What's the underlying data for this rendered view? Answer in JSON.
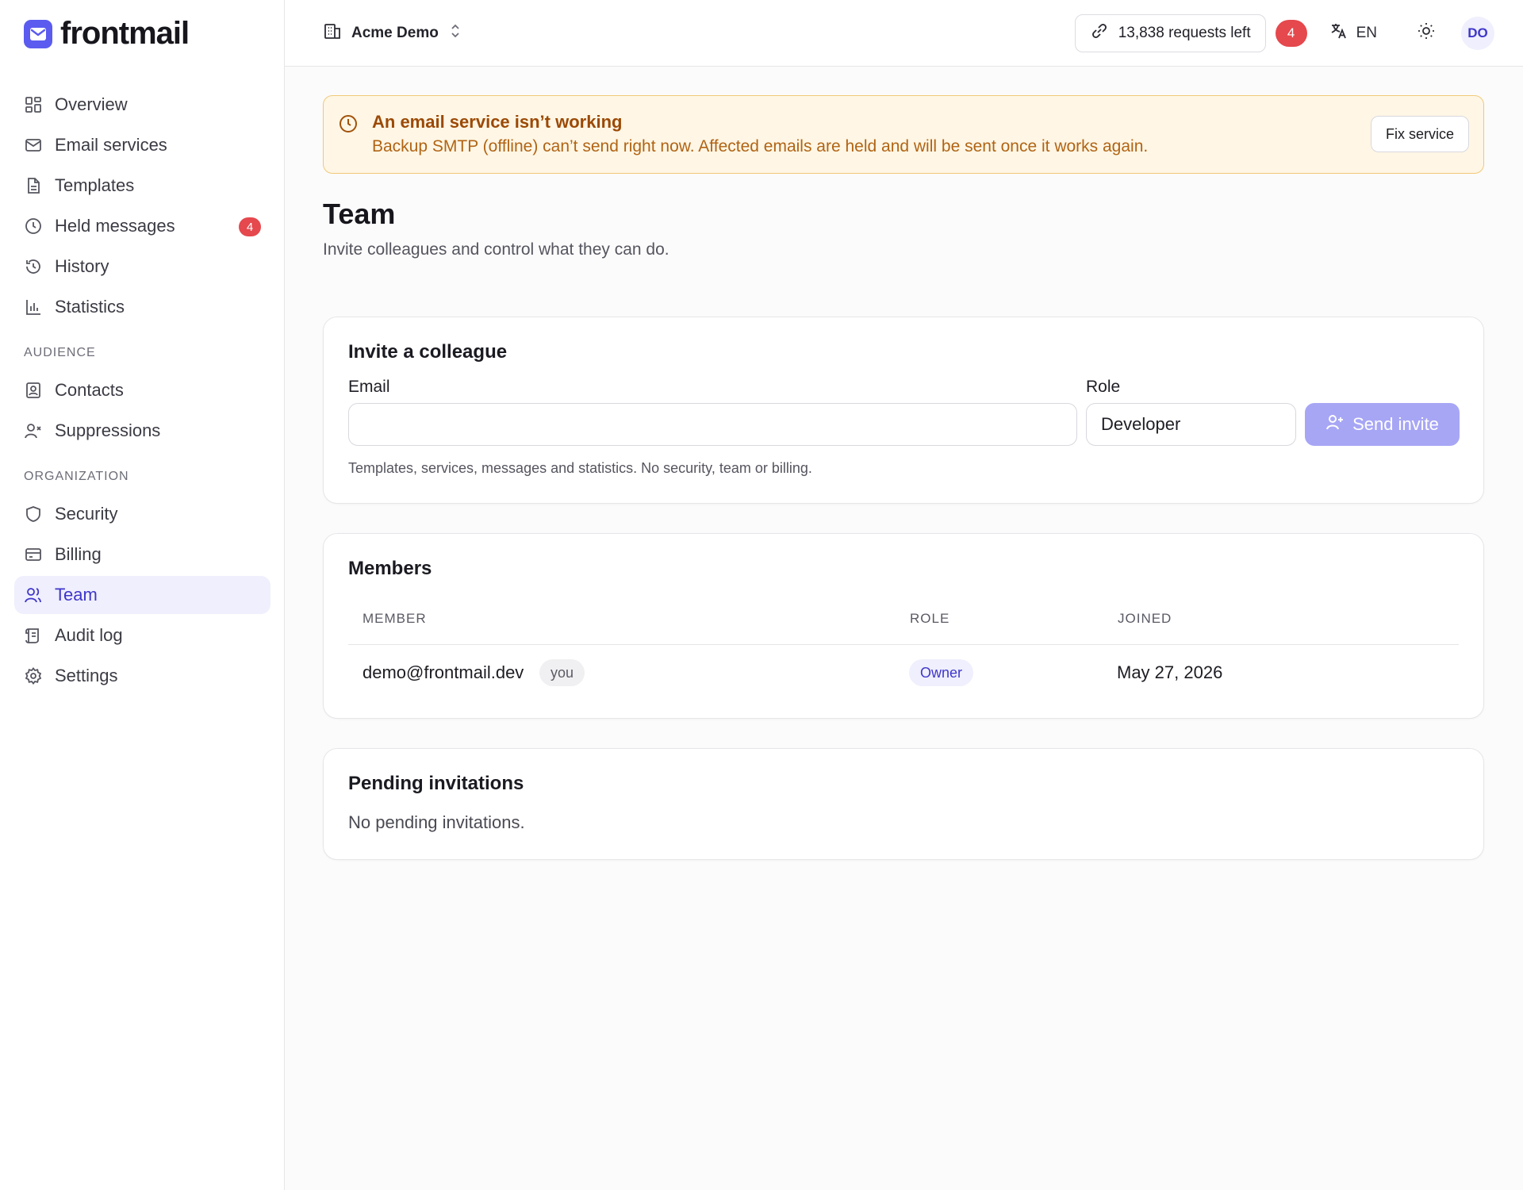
{
  "app": {
    "name": "frontmail"
  },
  "sidebar": {
    "items": [
      {
        "label": "Overview",
        "icon": "overview-icon"
      },
      {
        "label": "Email services",
        "icon": "mail-icon"
      },
      {
        "label": "Templates",
        "icon": "file-icon"
      },
      {
        "label": "Held messages",
        "icon": "clock-icon",
        "badge": "4"
      },
      {
        "label": "History",
        "icon": "history-icon"
      },
      {
        "label": "Statistics",
        "icon": "bar-chart-icon"
      }
    ],
    "audience_heading": "AUDIENCE",
    "audience_items": [
      {
        "label": "Contacts",
        "icon": "contacts-icon"
      },
      {
        "label": "Suppressions",
        "icon": "user-x-icon"
      }
    ],
    "organization_heading": "ORGANIZATION",
    "organization_items": [
      {
        "label": "Security",
        "icon": "shield-icon"
      },
      {
        "label": "Billing",
        "icon": "credit-card-icon"
      },
      {
        "label": "Team",
        "icon": "users-icon",
        "active": true
      },
      {
        "label": "Audit log",
        "icon": "scroll-icon"
      },
      {
        "label": "Settings",
        "icon": "gear-icon"
      }
    ]
  },
  "topbar": {
    "org_name": "Acme Demo",
    "requests_left": "13,838 requests left",
    "notification_count": "4",
    "language": "EN",
    "avatar_initials": "DO"
  },
  "alert": {
    "title": "An email service isn’t working",
    "description": "Backup SMTP (offline) can’t send right now. Affected emails are held and will be sent once it works again.",
    "button": "Fix service"
  },
  "page": {
    "title": "Team",
    "subtitle": "Invite colleagues and control what they can do."
  },
  "invite": {
    "title": "Invite a colleague",
    "email_label": "Email",
    "email_value": "",
    "email_placeholder": "",
    "role_label": "Role",
    "role_value": "Developer",
    "send_button": "Send invite",
    "hint": "Templates, services, messages and statistics. No security, team or billing."
  },
  "members": {
    "title": "Members",
    "columns": [
      "MEMBER",
      "ROLE",
      "JOINED"
    ],
    "rows": [
      {
        "email": "demo@frontmail.dev",
        "you_tag": "you",
        "role": "Owner",
        "joined": "May 27, 2026"
      }
    ]
  },
  "pending": {
    "title": "Pending invitations",
    "empty": "No pending invitations."
  },
  "colors": {
    "accent": "#5b5bf0",
    "active_bg": "#efeffd",
    "danger": "#e5484d",
    "warning_bg": "#fff6e5",
    "warning_border": "#f0c97a",
    "warning_text": "#9b4a06",
    "disabled_button": "#a7a6f5"
  }
}
